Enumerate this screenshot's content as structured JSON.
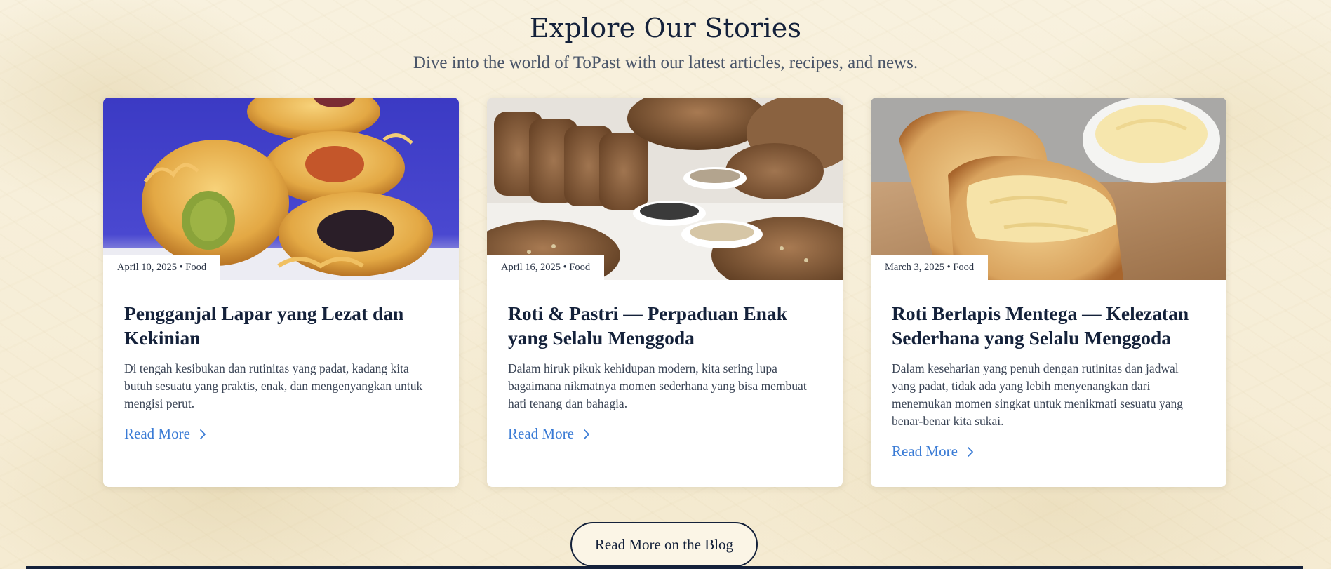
{
  "header": {
    "title": "Explore Our Stories",
    "subtitle": "Dive into the world of ToPast with our latest articles, recipes, and news."
  },
  "posts": [
    {
      "image_alt": "stacked pastries with colorful fillings on blue background",
      "meta": "April 10, 2025 • Food",
      "title": "Pengganjal Lapar yang Lezat dan Kekinian",
      "excerpt": "Di tengah kesibukan dan rutinitas yang padat, kadang kita butuh sesuatu yang praktis, enak, dan mengenyangkan untuk mengisi perut.",
      "read_more": "Read More"
    },
    {
      "image_alt": "whole grain breads and bowls of seeds",
      "meta": "April 16, 2025 • Food",
      "title": "Roti & Pastri — Perpaduan Enak yang Selalu Menggoda",
      "excerpt": "Dalam hiruk pikuk kehidupan modern, kita sering lupa bagaimana nikmatnya momen sederhana yang bisa membuat hati tenang dan bahagia.",
      "read_more": "Read More"
    },
    {
      "image_alt": "toasted bread slices with butter and a bowl of butter",
      "meta": "March 3, 2025 • Food",
      "title": "Roti Berlapis Mentega — Kelezatan Sederhana yang Selalu Menggoda",
      "excerpt": "Dalam keseharian yang penuh dengan rutinitas dan jadwal yang padat, tidak ada yang lebih menyenangkan dari menemukan momen singkat untuk menikmati sesuatu yang benar-benar kita sukai.",
      "read_more": "Read More"
    }
  ],
  "cta": {
    "label": "Read More on the Blog"
  },
  "colors": {
    "background": "#f7efd9",
    "heading": "#14213a",
    "link": "#3a7bd5",
    "card": "#ffffff"
  },
  "icons": {
    "read_more": "chevron-right-icon"
  }
}
